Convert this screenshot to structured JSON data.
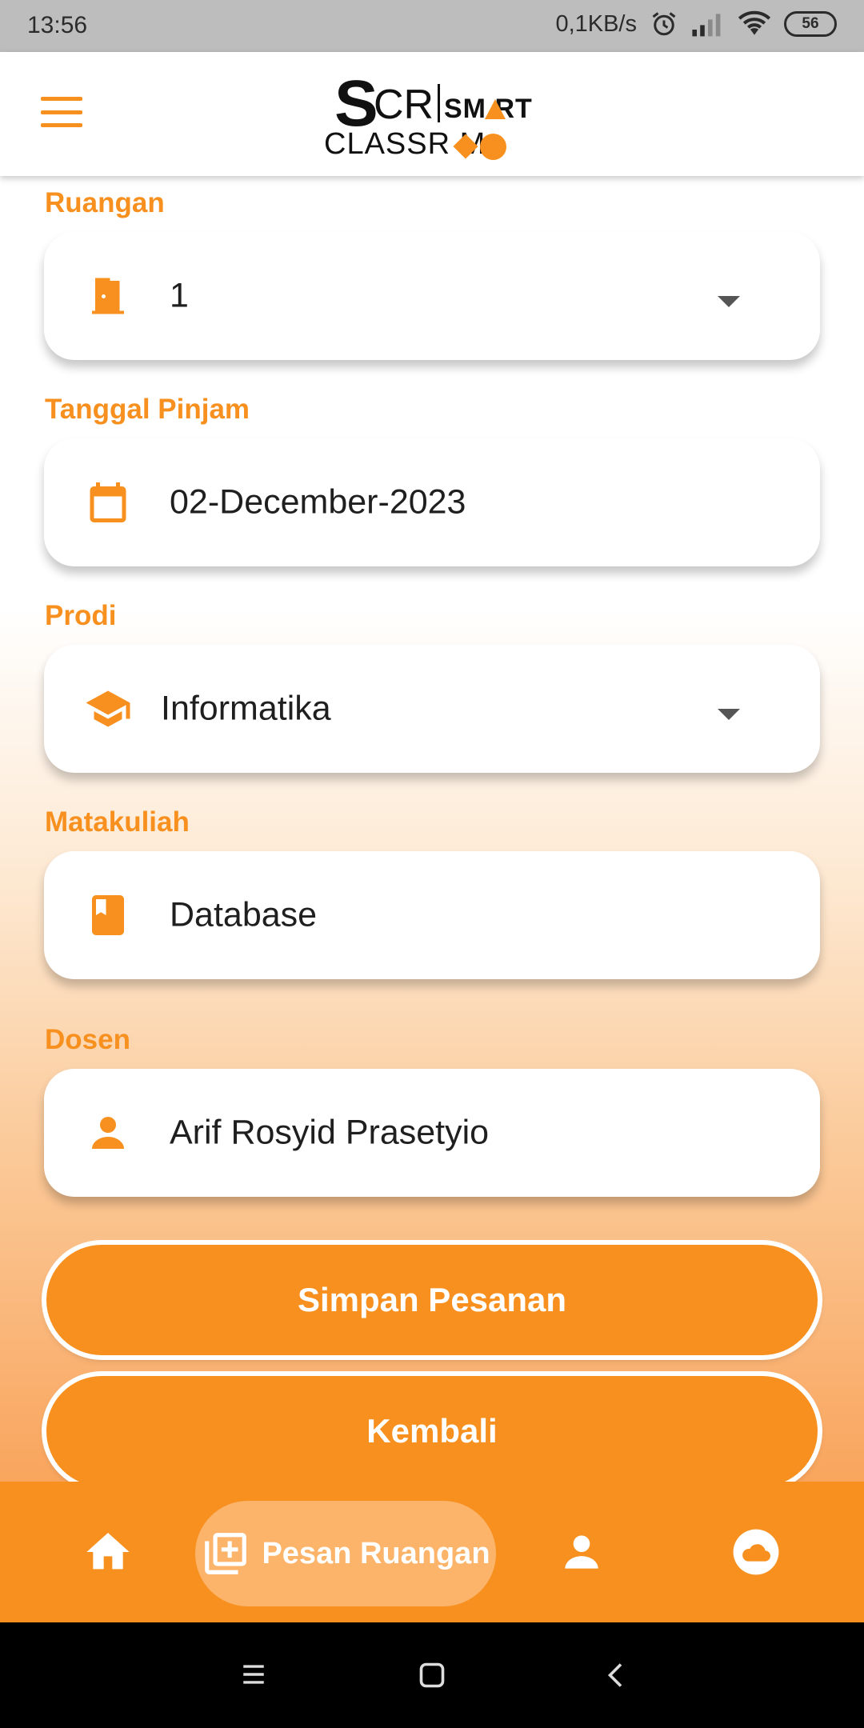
{
  "status_bar": {
    "time": "13:56",
    "speed": "0,1KB/s",
    "battery": "56"
  },
  "header": {
    "logo": {
      "s": "S",
      "cr": "CR",
      "smart": "SM RT",
      "classroom": "CLASSR    M"
    }
  },
  "form": {
    "ruangan": {
      "label": "Ruangan",
      "value": "1",
      "icon": "door-icon"
    },
    "tanggal": {
      "label": "Tanggal Pinjam",
      "value": "02-December-2023",
      "icon": "calendar-icon"
    },
    "prodi": {
      "label": "Prodi",
      "value": "Informatika",
      "icon": "graduation-cap-icon"
    },
    "matakuliah": {
      "label": "Matakuliah",
      "value": "Database",
      "icon": "book-icon"
    },
    "dosen": {
      "label": "Dosen",
      "value": "Arif Rosyid Prasetyio",
      "icon": "person-icon"
    }
  },
  "buttons": {
    "save": "Simpan Pesanan",
    "back": "Kembali"
  },
  "bottom_nav": {
    "items": [
      {
        "icon": "home-icon"
      },
      {
        "icon": "add-box-icon",
        "label": "Pesan Ruangan",
        "active": true
      },
      {
        "icon": "person-icon"
      },
      {
        "icon": "cloud-icon"
      }
    ]
  },
  "colors": {
    "accent": "#f7901e",
    "accent_light": "#fbb46a"
  }
}
